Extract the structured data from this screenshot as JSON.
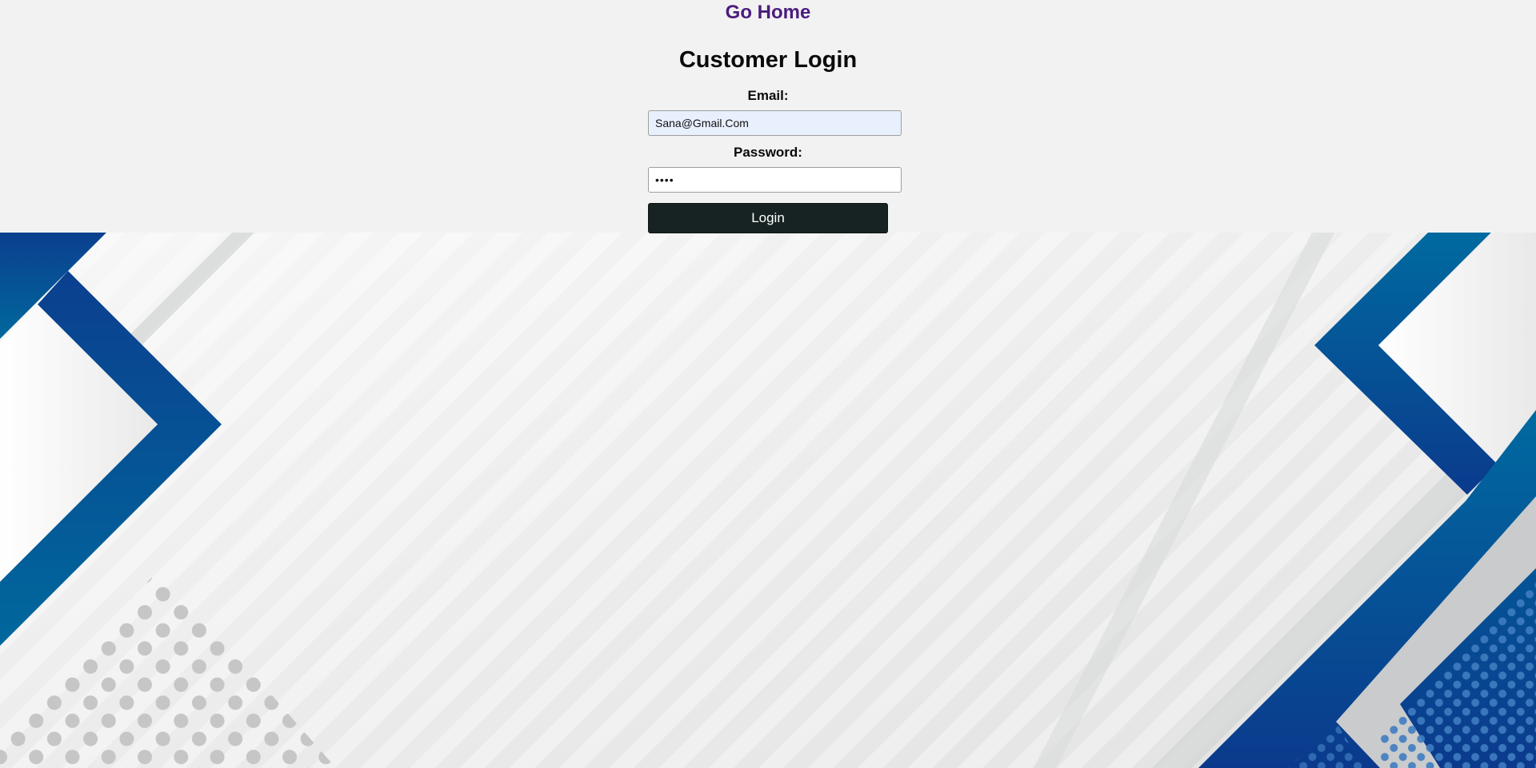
{
  "nav": {
    "home_label": "Go Home"
  },
  "login": {
    "title": "Customer Login",
    "email_label": "Email:",
    "email_value": "Sana@Gmail.Com",
    "password_label": "Password:",
    "password_value": "sana",
    "submit_label": "Login"
  },
  "colors": {
    "link": "#4b1c7d",
    "button": "#172323",
    "autofill": "#e8f0fe",
    "accent_blue": "#0a4aa0",
    "accent_teal": "#00689c"
  }
}
